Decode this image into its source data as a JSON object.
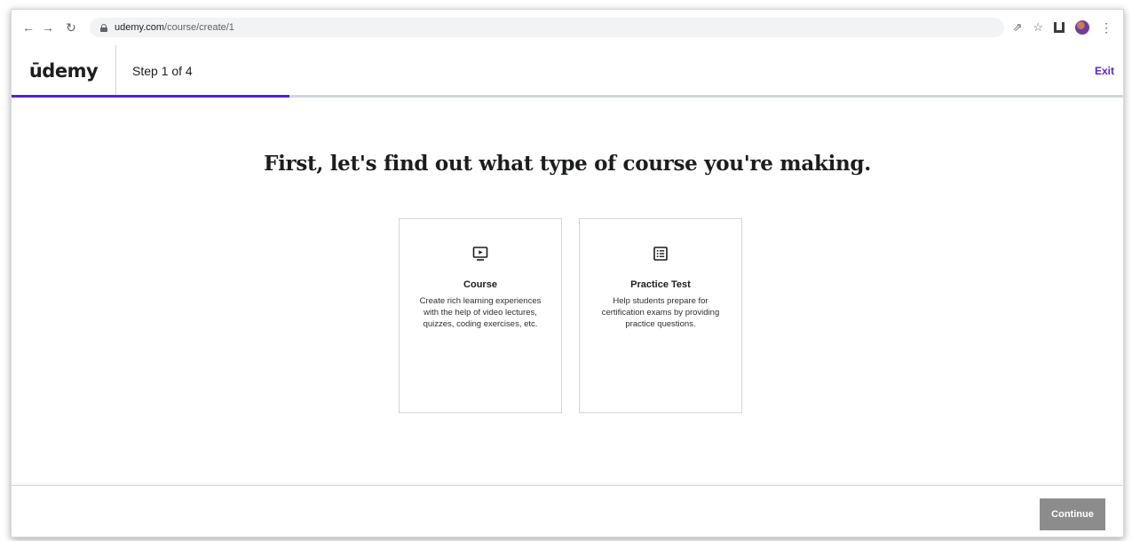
{
  "browser": {
    "url_host": "udemy.com",
    "url_path": "/course/create/1"
  },
  "header": {
    "logo_text": "ūdemy",
    "step_text": "Step 1 of 4",
    "exit_label": "Exit",
    "progress_percent": 25
  },
  "main": {
    "headline": "First, let's find out what type of course you're making.",
    "cards": [
      {
        "icon": "video-play-icon",
        "title": "Course",
        "description": "Create rich learning experiences with the help of video lectures, quizzes, coding exercises, etc."
      },
      {
        "icon": "list-document-icon",
        "title": "Practice Test",
        "description": "Help students prepare for certification exams by providing practice questions."
      }
    ]
  },
  "footer": {
    "continue_label": "Continue"
  },
  "colors": {
    "brand_purple": "#5624d0",
    "logo_accent": "#a435f0",
    "disabled_button": "#8c8c8c"
  }
}
